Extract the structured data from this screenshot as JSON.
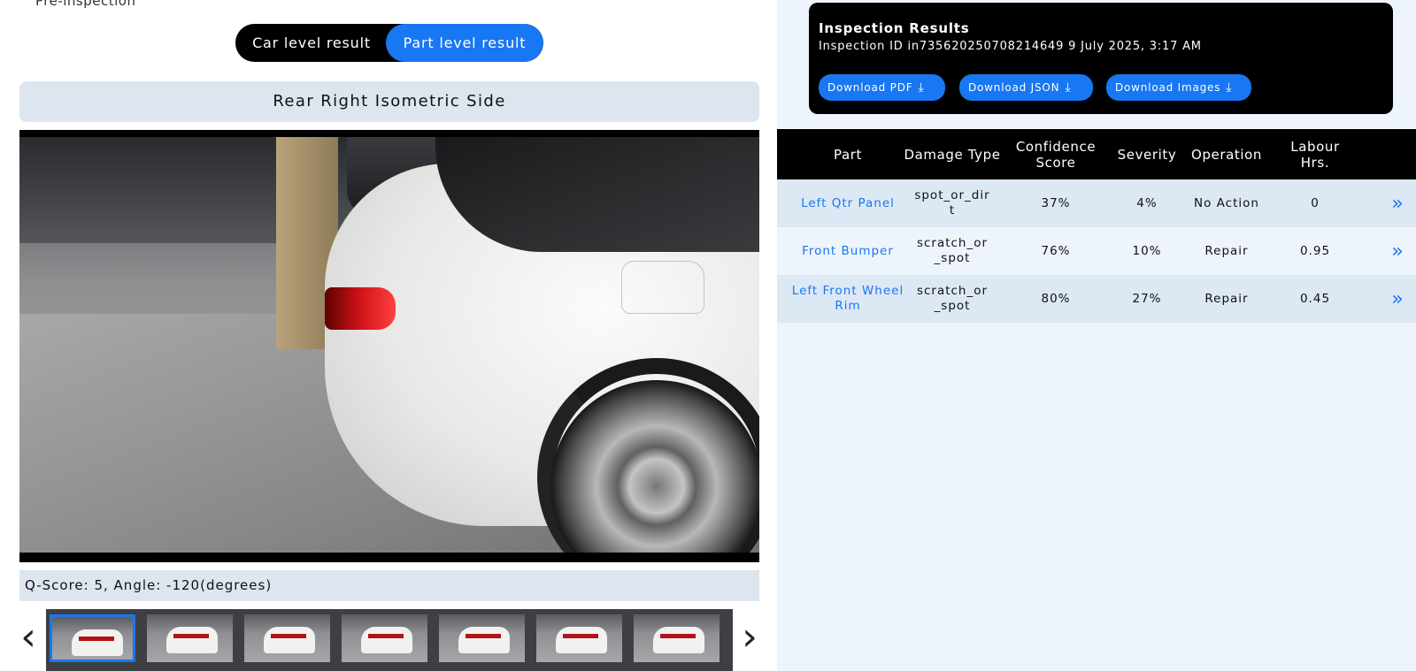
{
  "top_crumb": "Pre-inspection",
  "toggle": {
    "car_label": "Car level result",
    "part_label": "Part level result",
    "selected": "part"
  },
  "view_title": "Rear Right Isometric Side",
  "qscore_text": "Q-Score: 5, Angle: -120(degrees)",
  "thumbnails": {
    "count": 7,
    "selected_index": 0
  },
  "results": {
    "title": "Inspection Results",
    "meta": "Inspection ID in735620250708214649 9 July 2025, 3:17 AM",
    "buttons": {
      "pdf": "Download PDF",
      "json": "Download JSON",
      "images": "Download Images"
    },
    "download_icon": "download-icon"
  },
  "table": {
    "headers": {
      "part": "Part",
      "damage_type": "Damage Type",
      "confidence": "Confidence Score",
      "severity": "Severity",
      "operation": "Operation",
      "labour": "Labour Hrs."
    },
    "rows": [
      {
        "part": "Left Qtr Panel",
        "damage_type": "spot_or_dirt",
        "confidence": "37%",
        "severity": "4%",
        "operation": "No Action",
        "labour": "0"
      },
      {
        "part": "Front Bumper",
        "damage_type": "scratch_or_spot",
        "confidence": "76%",
        "severity": "10%",
        "operation": "Repair",
        "labour": "0.95"
      },
      {
        "part": "Left Front Wheel Rim",
        "damage_type": "scratch_or_spot",
        "confidence": "80%",
        "severity": "27%",
        "operation": "Repair",
        "labour": "0.45"
      }
    ],
    "row_action_icon": "double-chevron-right-icon"
  },
  "colors": {
    "accent": "#1877f2",
    "panel": "#dde5ee",
    "right_bg": "#eef4fb"
  }
}
